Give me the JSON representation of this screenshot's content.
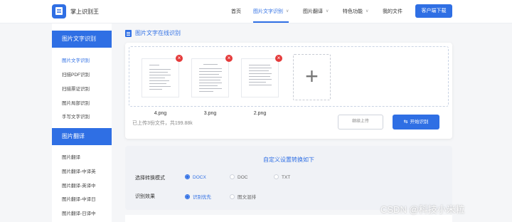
{
  "header": {
    "brand": "掌上识别王",
    "nav": [
      {
        "label": "首页"
      },
      {
        "label": "图片文字识别"
      },
      {
        "label": "图片翻译"
      },
      {
        "label": "特色功能"
      },
      {
        "label": "我的文件"
      }
    ],
    "download_label": "客户端下载"
  },
  "sidebar": {
    "group1_title": "图片文字识别",
    "group1_items": [
      "图片文字识别",
      "扫描PDF识别",
      "扫描票证识别",
      "图片局部识别",
      "手写文字识别"
    ],
    "group2_title": "图片翻译",
    "group2_items": [
      "图片翻译",
      "图片翻译-中译英",
      "图片翻译-英译中",
      "图片翻译-中译日",
      "图片翻译-日译中"
    ]
  },
  "main": {
    "section_title": "图片文字在线识别",
    "files": [
      {
        "name": "4.png"
      },
      {
        "name": "3.png"
      },
      {
        "name": "2.png"
      }
    ],
    "add_symbol": "+",
    "upload_status": "已上传3份文件，共199.88k",
    "continue_label": "继续上传",
    "start_label": "开始识别",
    "start_icon": "⇆"
  },
  "settings": {
    "title": "自定义设置转换如下",
    "mode_label": "选择转换模式",
    "modes": [
      "DOCX",
      "DOC",
      "TXT"
    ],
    "effect_label": "识别效果",
    "effects": [
      "识别优先",
      "图文混排"
    ]
  },
  "watermark": "CSDN @科技小米粒",
  "colors": {
    "accent": "#2f6fe4",
    "remove": "#e53b3b"
  }
}
